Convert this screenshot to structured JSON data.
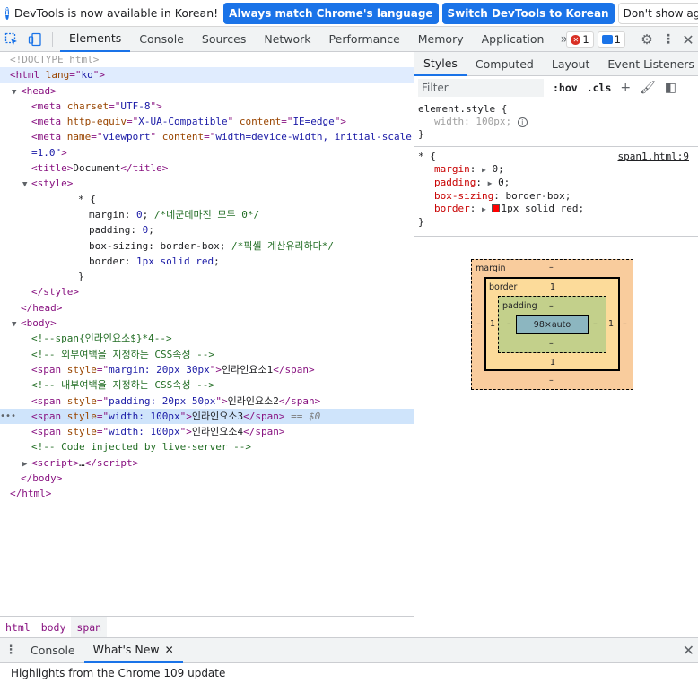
{
  "infobar": {
    "message": "DevTools is now available in Korean!",
    "btn_match": "Always match Chrome's language",
    "btn_switch": "Switch DevTools to Korean",
    "btn_dismiss": "Don't show again"
  },
  "toolbar": {
    "tabs": [
      "Elements",
      "Console",
      "Sources",
      "Network",
      "Performance",
      "Memory",
      "Application"
    ],
    "more": "»",
    "error_count": "1",
    "message_count": "1"
  },
  "elements": {
    "doctype": "<!DOCTYPE html>",
    "html_lang": "ko",
    "meta_charset": "UTF-8",
    "meta_httpequiv": "X-UA-Compatible",
    "meta_httpequiv_content": "IE=edge",
    "meta_viewport": "viewport",
    "meta_viewport_content_1": "width=device-width, initial-scale",
    "meta_viewport_content_2": "=1.0\"",
    "title_text": "Document",
    "css_selector": "* {",
    "css_margin_prop": "margin",
    "css_margin_val": "0",
    "css_margin_comment": "/*네군데마진 모두 0*/",
    "css_padding_prop": "padding",
    "css_padding_val": "0",
    "css_boxsizing_prop": "box-sizing",
    "css_boxsizing_val": "border-box",
    "css_boxsizing_comment": "/*픽셀 계산유리하다*/",
    "css_border_prop": "border",
    "css_border_val": "1px solid red",
    "css_close": "}",
    "comment1": "<!--span{인라인요소$}*4-->",
    "comment2": "<!-- 외부여백을 지정하는 CSS속성 -->",
    "span1_style": "margin: 20px 30px",
    "span1_text": "인라인요소1",
    "comment3": "<!-- 내부여백을 지정하는 CSS속성 -->",
    "span2_style": "padding: 20px 50px",
    "span2_text": "인라인요소2",
    "span3_style": "width: 100px",
    "span3_text": "인라인요소3",
    "span3_ref": "== $0",
    "span4_style": "width: 100px",
    "span4_text": "인라인요소4",
    "comment4": "<!-- Code injected by live-server -->",
    "script_collapsed": "…"
  },
  "breadcrumbs": [
    "html",
    "body",
    "span"
  ],
  "styles_panel": {
    "tabs": [
      "Styles",
      "Computed",
      "Layout",
      "Event Listeners"
    ],
    "more": "»",
    "filter_placeholder": "Filter",
    "hov": ":hov",
    "cls": ".cls",
    "element_style_selector": "element.style {",
    "element_style_prop": "width",
    "element_style_val": "100px;",
    "element_style_close": "}",
    "rule_selector": "* {",
    "rule_source": "span1.html:9",
    "rule_props": [
      {
        "name": "margin",
        "value": "0;"
      },
      {
        "name": "padding",
        "value": "0;"
      },
      {
        "name": "box-sizing",
        "value": "border-box;"
      },
      {
        "name": "border",
        "value": "1px solid red;"
      }
    ],
    "rule_close": "}"
  },
  "box_model": {
    "margin_label": "margin",
    "margin_top": "–",
    "margin_bottom": "–",
    "margin_left": "–",
    "margin_right": "–",
    "border_label": "border",
    "border_top": "1",
    "border_bottom": "1",
    "border_left": "1",
    "border_right": "1",
    "padding_label": "padding",
    "padding_top": "–",
    "padding_bottom": "–",
    "padding_left": "–",
    "padding_right": "–",
    "content": "98×auto"
  },
  "drawer": {
    "tabs": [
      "Console",
      "What's New"
    ],
    "body_text": "Highlights from the Chrome 109 update"
  },
  "colors": {
    "accent": "#1a73e8",
    "error": "#d93025",
    "tag": "#881280",
    "attr": "#994500",
    "value": "#1a1aa6",
    "comment": "#236e25",
    "selected_row": "#cfe4fb"
  }
}
